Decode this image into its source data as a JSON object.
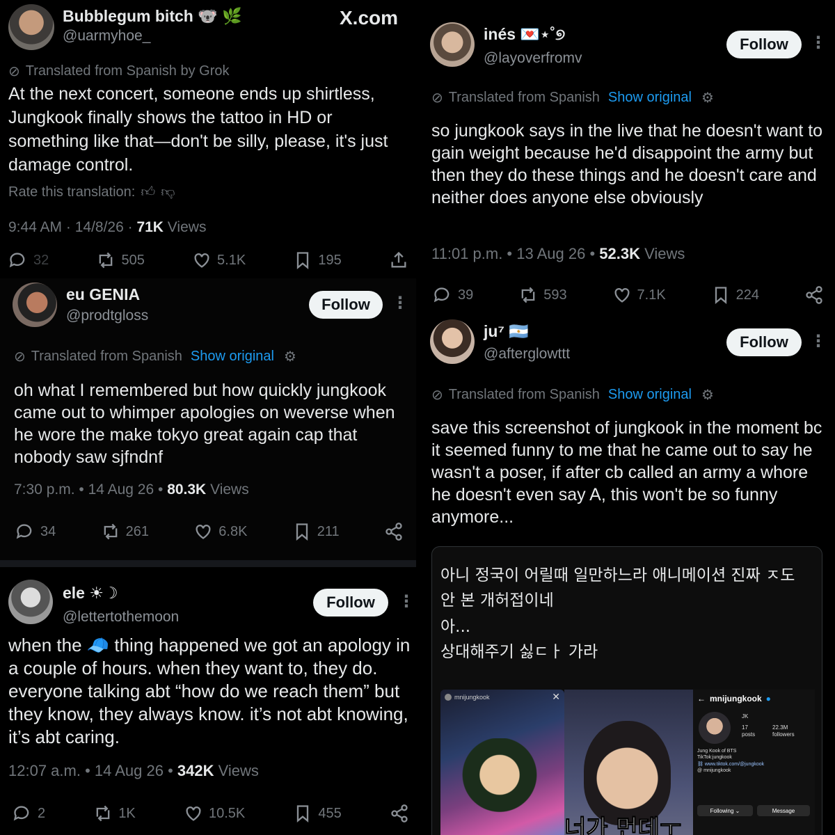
{
  "xlogo": "X.com",
  "p1": {
    "name": "Bubblegum bitch",
    "name_emoji": "🐨 🌿",
    "handle": "@uarmyhoe_",
    "translated": "Translated from Spanish by Grok",
    "text": "At the next concert, someone ends up shirtless, Jungkook finally shows the tattoo in HD or something like that—don't be silly, please, it's just damage control.",
    "rate": "Rate this translation:",
    "time": "9:44 AM · 14/8/26 · ",
    "views": "71K",
    "views_label": " Views",
    "replies": "32",
    "reposts": "505",
    "likes": "5.1K",
    "bookmarks": "195"
  },
  "p2": {
    "name": "eu GENIA",
    "handle": "@prodtgloss",
    "follow": "Follow",
    "translated": "Translated from Spanish",
    "show_original": "Show original",
    "text": "oh what I remembered but how quickly jungkook came out to whimper apologies on weverse when he wore the make tokyo great again cap that nobody saw sjfndnf",
    "time": "7:30 p.m. • 14 Aug 26 • ",
    "views": "80.3K",
    "views_label": " Views",
    "replies": "34",
    "reposts": "261",
    "likes": "6.8K",
    "bookmarks": "211"
  },
  "p3": {
    "name": "ele ☀︎☽",
    "handle": "@lettertothemoon",
    "follow": "Follow",
    "text_before": "when the ",
    "cap_emoji": "🧢",
    "text_after": " thing happened we got an apology in a couple of hours. when they want to, they do. everyone talking abt “how do we reach them” but they know, they always know. it’s not abt knowing, it’s abt caring.",
    "time": "12:07 a.m. • 14 Aug 26 • ",
    "views": "342K",
    "views_label": " Views",
    "replies": "2",
    "reposts": "1K",
    "likes": "10.5K",
    "bookmarks": "455"
  },
  "p4": {
    "name": "inés 💌⋆˚୭",
    "handle": "@layoverfromv",
    "follow": "Follow",
    "translated": "Translated from Spanish",
    "show_original": "Show original",
    "text": "so jungkook says in the live that he doesn't want to gain weight because he'd disappoint the army but then they do these things and he doesn't care and neither does anyone else obviously",
    "time": "11:01 p.m. • 13 Aug 26 • ",
    "views": "52.3K",
    "views_label": " Views",
    "replies": "39",
    "reposts": "593",
    "likes": "7.1K",
    "bookmarks": "224"
  },
  "p5": {
    "name": "ju⁷ 🇦🇷",
    "handle": "@afterglowttt",
    "follow": "Follow",
    "translated": "Translated from Spanish",
    "show_original": "Show original",
    "text": "save this screenshot of jungkook in the moment bc it seemed funny to me that he came out to say he wasn't a poser, if after cb called an army a whore he doesn't even say A, this won't be so funny anymore...",
    "embed": {
      "line1": "아니 정국이 어릴때 일만하느라 애니메이션 진짜 ㅈ도",
      "line2": "안 본 개허접이네",
      "line3": "아...",
      "line4": "상대해주기 싫ㄷㅏ 가라",
      "profile_name": "mnijungkook",
      "jk": "JK",
      "posts_n": "17",
      "posts_l": "posts",
      "followers_n": "22.3M",
      "followers_l": "followers",
      "bio1": "Jung Kook of BTS",
      "bio2": "TikTok:jungkook",
      "link": "www.tiktok.com/@jungkook",
      "threads": "mnijungkook",
      "following_btn": "Following ⌄",
      "message_btn": "Message",
      "caption": "너가 먼데ㅜ",
      "story_user": "mnijungkook"
    }
  },
  "colors": {
    "accent": "#1d9bf0",
    "bg": "#000000",
    "muted": "#71767b"
  }
}
